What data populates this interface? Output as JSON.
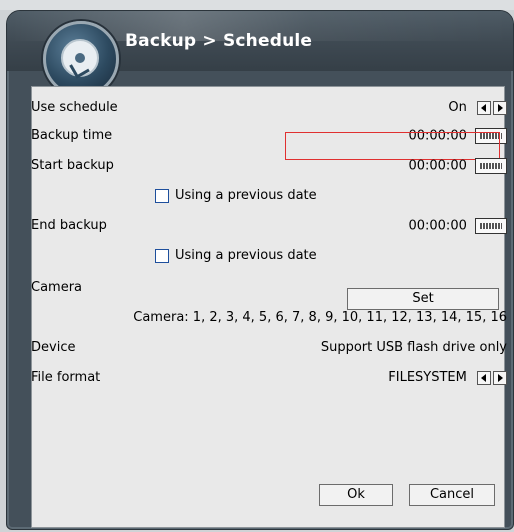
{
  "header": {
    "title": "Backup > Schedule"
  },
  "use_schedule": {
    "label": "Use schedule",
    "value": "On"
  },
  "backup_time": {
    "label": "Backup time",
    "value": "00:00:00"
  },
  "start_backup": {
    "label": "Start backup",
    "value": "00:00:00",
    "checkbox_label": "Using a previous date"
  },
  "end_backup": {
    "label": "End backup",
    "value": "00:00:00",
    "checkbox_label": "Using a previous date"
  },
  "camera": {
    "label": "Camera",
    "set_button": "Set",
    "camera_list": "Camera: 1, 2, 3, 4, 5, 6, 7, 8, 9, 10, 11, 12, 13, 14, 15, 16"
  },
  "device": {
    "label": "Device",
    "value": "Support USB flash drive only"
  },
  "file_format": {
    "label": "File format",
    "value": "FILESYSTEM"
  },
  "footer": {
    "ok_label": "Ok",
    "cancel_label": "Cancel"
  },
  "colors": {
    "header": "#44505a",
    "panel": "#e9e9e9",
    "highlight": "#e03030",
    "checkbox_border": "#1e4f9c"
  }
}
